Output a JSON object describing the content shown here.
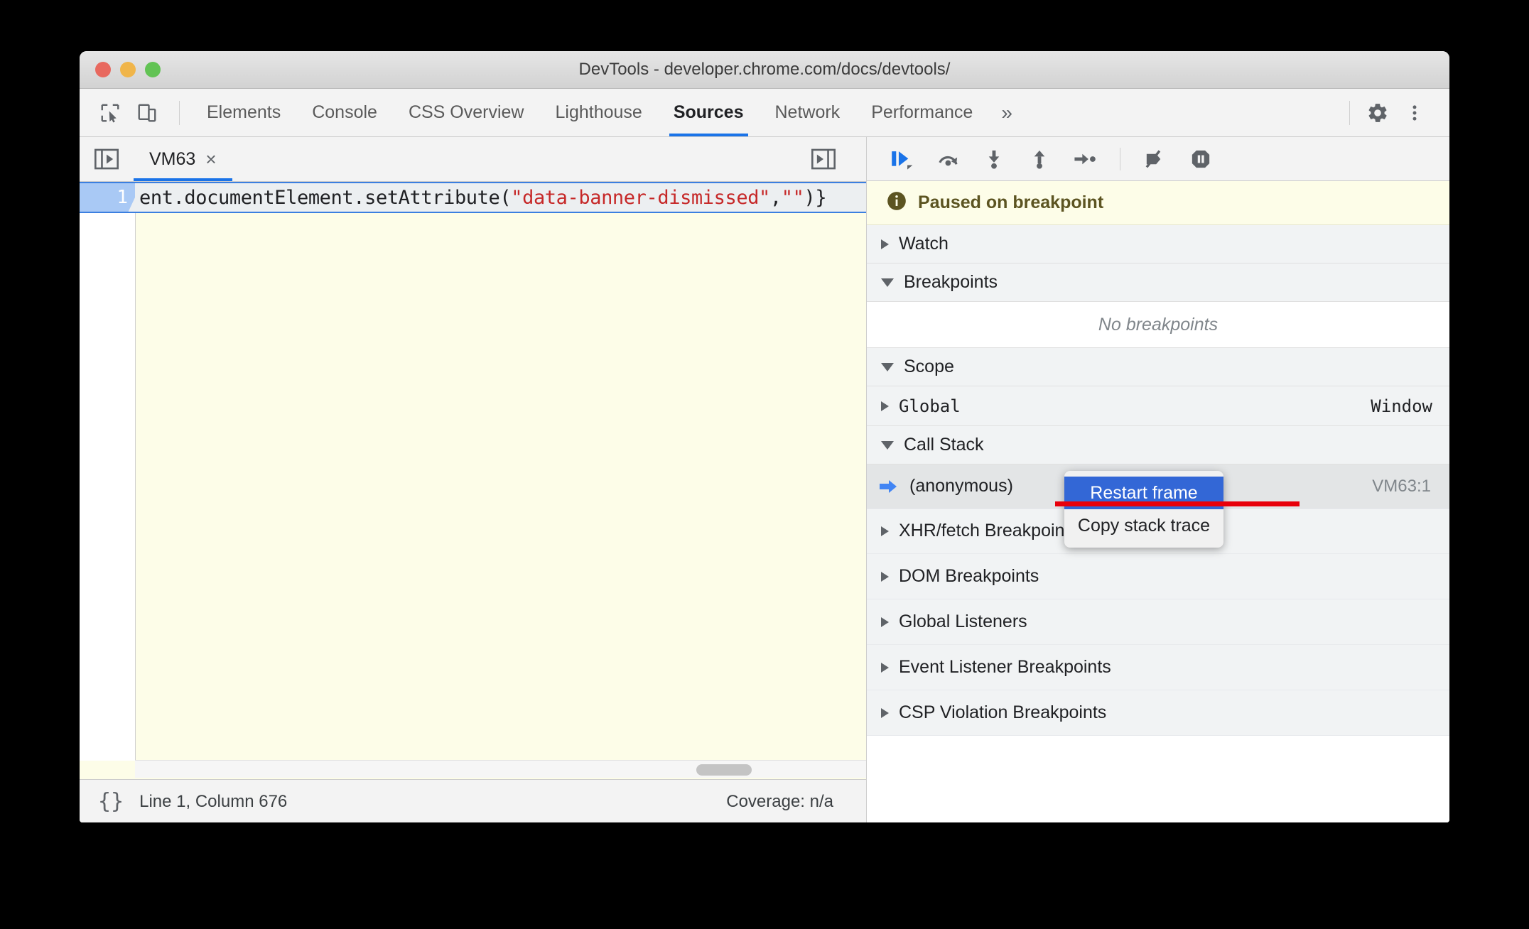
{
  "window": {
    "title": "DevTools - developer.chrome.com/docs/devtools/",
    "traffic_lights": [
      "close",
      "minimize",
      "zoom"
    ]
  },
  "devtools_toolbar": {
    "left_icons": [
      {
        "name": "inspect-element-icon",
        "label": "Inspect element"
      },
      {
        "name": "device-toolbar-icon",
        "label": "Toggle device toolbar"
      }
    ],
    "tabs": [
      {
        "label": "Elements",
        "active": false
      },
      {
        "label": "Console",
        "active": false
      },
      {
        "label": "CSS Overview",
        "active": false
      },
      {
        "label": "Lighthouse",
        "active": false
      },
      {
        "label": "Sources",
        "active": true
      },
      {
        "label": "Network",
        "active": false
      },
      {
        "label": "Performance",
        "active": false
      }
    ],
    "more_tabs_label": "»",
    "right_icons": [
      {
        "name": "settings-gear-icon",
        "label": "Settings"
      },
      {
        "name": "more-options-icon",
        "label": "Customize and control DevTools"
      }
    ]
  },
  "editor": {
    "navigator_toggle_label": "Show navigator",
    "file_tab": {
      "label": "VM63",
      "close_label": "×"
    },
    "more_tabs_label": "Show more tabs",
    "line_number": "1",
    "code_segments": [
      {
        "text": "ent.documentElement.setAttribute(",
        "type": "plain"
      },
      {
        "text": "\"data-banner-dismissed\"",
        "type": "string"
      },
      {
        "text": ",",
        "type": "plain"
      },
      {
        "text": "\"\"",
        "type": "string"
      },
      {
        "text": ")}",
        "type": "plain"
      }
    ],
    "status": {
      "format_label": "{}",
      "cursor_position": "Line 1, Column 676",
      "coverage": "Coverage: n/a"
    }
  },
  "debugger": {
    "toolbar_buttons": [
      {
        "name": "resume-script-execution-icon",
        "label": "Resume script execution",
        "active": true
      },
      {
        "name": "step-over-icon",
        "label": "Step over next function call",
        "active": false
      },
      {
        "name": "step-into-icon",
        "label": "Step into next function call",
        "active": false
      },
      {
        "name": "step-out-icon",
        "label": "Step out of current function",
        "active": false
      },
      {
        "name": "step-icon",
        "label": "Step",
        "active": false
      },
      {
        "name": "deactivate-breakpoints-icon",
        "label": "Deactivate breakpoints",
        "active": false
      },
      {
        "name": "pause-on-exceptions-icon",
        "label": "Pause on exceptions",
        "active": false
      }
    ],
    "paused_banner": {
      "icon": "info-icon",
      "text": "Paused on breakpoint"
    },
    "sections": {
      "watch": {
        "label": "Watch",
        "expanded": false
      },
      "breakpoints": {
        "label": "Breakpoints",
        "expanded": true,
        "empty_text": "No breakpoints"
      },
      "scope": {
        "label": "Scope",
        "expanded": true
      },
      "scope_rows": [
        {
          "name": "Global",
          "value": "Window",
          "expanded": false
        }
      ],
      "call_stack": {
        "label": "Call Stack",
        "expanded": true
      },
      "call_frames": [
        {
          "name": "(anonymous)",
          "location": "VM63:1",
          "selected": true
        }
      ],
      "breakpoint_categories": [
        {
          "label": "XHR/fetch Breakpoints",
          "expanded": false
        },
        {
          "label": "DOM Breakpoints",
          "expanded": false
        },
        {
          "label": "Global Listeners",
          "expanded": false
        },
        {
          "label": "Event Listener Breakpoints",
          "expanded": false
        },
        {
          "label": "CSP Violation Breakpoints",
          "expanded": false
        }
      ]
    }
  },
  "context_menu": {
    "items": [
      {
        "label": "Restart frame",
        "highlighted": true
      },
      {
        "label": "Copy stack trace",
        "highlighted": false
      }
    ]
  },
  "annotation": {
    "strikethrough_color": "#e8000b"
  },
  "colors": {
    "accent_blue": "#1a73e8",
    "menu_highlight": "#3367d6",
    "code_string": "#c62828",
    "paused_bg": "#fdfde8",
    "paused_text": "#5c5421"
  }
}
